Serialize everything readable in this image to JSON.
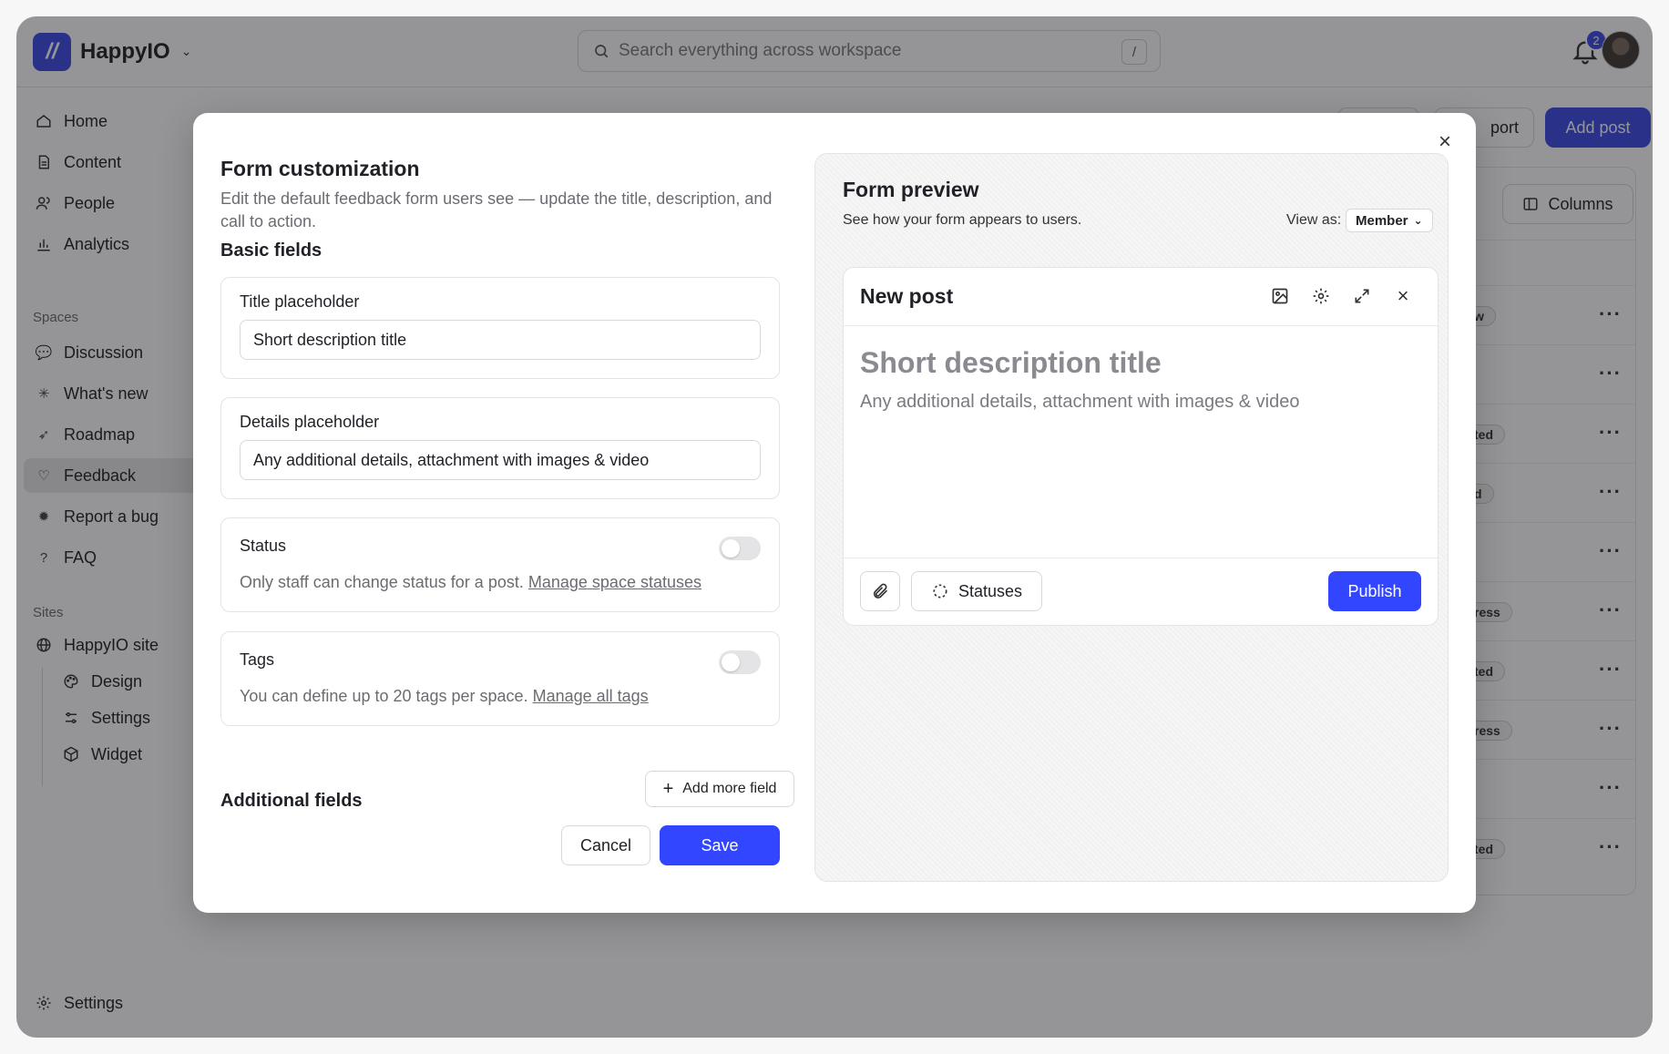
{
  "app": {
    "name": "HappyIO",
    "search_placeholder": "Search everything across workspace",
    "search_shortcut": "/",
    "notification_count": "2"
  },
  "sidebar": {
    "main": [
      {
        "label": "Home",
        "icon": "home-icon"
      },
      {
        "label": "Content",
        "icon": "document-icon"
      },
      {
        "label": "People",
        "icon": "people-icon"
      },
      {
        "label": "Analytics",
        "icon": "chart-icon"
      }
    ],
    "spaces_label": "Spaces",
    "spaces": [
      {
        "label": "Discussion",
        "icon": "speech-bubble-icon"
      },
      {
        "label": "What's new",
        "icon": "sparkle-icon"
      },
      {
        "label": "Roadmap",
        "icon": "rocket-icon"
      },
      {
        "label": "Feedback",
        "icon": "heart-icon",
        "active": true
      },
      {
        "label": "Report a bug",
        "icon": "bug-icon"
      },
      {
        "label": "FAQ",
        "icon": "question-icon"
      }
    ],
    "sites_label": "Sites",
    "site": {
      "label": "HappyIO site",
      "icon": "globe-icon"
    },
    "site_children": [
      {
        "label": "Design",
        "icon": "palette-icon"
      },
      {
        "label": "Settings",
        "icon": "sliders-icon"
      },
      {
        "label": "Widget",
        "icon": "cube-icon"
      }
    ],
    "bottom": {
      "label": "Settings",
      "icon": "gear-icon"
    }
  },
  "background": {
    "import_label": "port",
    "add_post_label": "Add post",
    "columns_label": "Columns",
    "row_statuses": [
      "w",
      "",
      "ted",
      "d",
      "",
      "ress",
      "ted",
      "ress",
      "",
      "ted"
    ]
  },
  "modal": {
    "title": "Form customization",
    "description": "Edit the default feedback form users see — update the title, description, and call to action.",
    "basic_fields_heading": "Basic fields",
    "title_field": {
      "label": "Title placeholder",
      "value": "Short description title"
    },
    "details_field": {
      "label": "Details placeholder",
      "value": "Any additional details, attachment with images & video"
    },
    "status_field": {
      "label": "Status",
      "help": "Only staff can change status for a post.",
      "link": "Manage space statuses",
      "enabled": false
    },
    "tags_field": {
      "label": "Tags",
      "help": "You can define up to 20 tags per space.",
      "link": "Manage all tags",
      "enabled": false
    },
    "additional_fields_heading": "Additional fields",
    "add_field_label": "Add more field",
    "cancel_label": "Cancel",
    "save_label": "Save"
  },
  "preview": {
    "title": "Form preview",
    "subtitle": "See how your form appears to users.",
    "view_as_label": "View as:",
    "view_as_value": "Member",
    "post_title": "New post",
    "placeholder_title": "Short description title",
    "placeholder_body": "Any additional details, attachment with images & video",
    "statuses_label": "Statuses",
    "publish_label": "Publish"
  },
  "colors": {
    "accent": "#3346ff",
    "brand": "#3b4ce4"
  }
}
